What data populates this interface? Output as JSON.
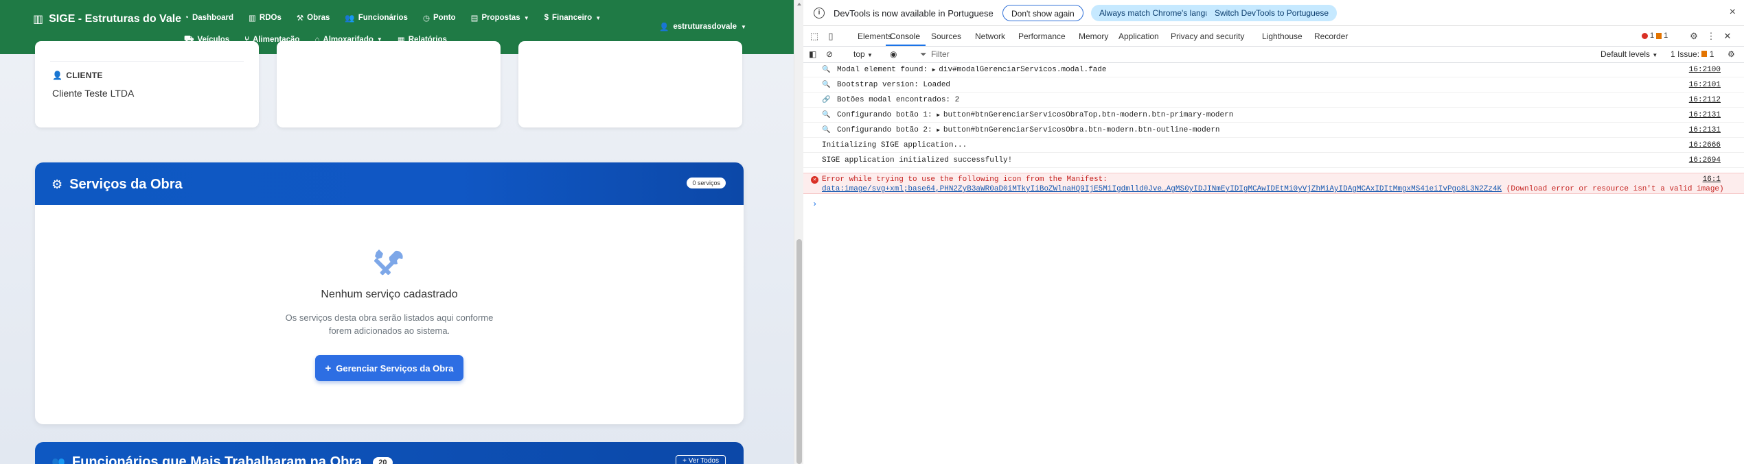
{
  "navbar": {
    "brand": "SIGE - Estruturas do Vale",
    "row1": [
      {
        "icon": "dashboard-icon",
        "glyph": "◔",
        "label": "Dashboard",
        "caret": false
      },
      {
        "icon": "building-icon",
        "glyph": "▥",
        "label": "RDOs",
        "caret": false
      },
      {
        "icon": "hammer-icon",
        "glyph": "⚒",
        "label": "Obras",
        "caret": false
      },
      {
        "icon": "users-icon",
        "glyph": "👥",
        "label": "Funcionários",
        "caret": false
      },
      {
        "icon": "clock-icon",
        "glyph": "◷",
        "label": "Ponto",
        "caret": false
      },
      {
        "icon": "file-icon",
        "glyph": "▤",
        "label": "Propostas",
        "caret": true
      },
      {
        "icon": "dollar-icon",
        "glyph": "$",
        "label": "Financeiro",
        "caret": true
      }
    ],
    "row2": [
      {
        "icon": "car-icon",
        "glyph": "⛟",
        "label": "Veículos",
        "caret": false
      },
      {
        "icon": "utensils-icon",
        "glyph": "⑂",
        "label": "Alimentação",
        "caret": false
      },
      {
        "icon": "warehouse-icon",
        "glyph": "⌂",
        "label": "Almoxarifado",
        "caret": true
      },
      {
        "icon": "chart-icon",
        "glyph": "▦",
        "label": "Relatórios",
        "caret": false
      }
    ],
    "user": "estruturasdovale"
  },
  "client": {
    "label": "CLIENTE",
    "name": "Cliente Teste LTDA"
  },
  "services": {
    "title": "Serviços da Obra",
    "badge": "0 serviços",
    "empty_title": "Nenhum serviço cadastrado",
    "empty_desc": "Os serviços desta obra serão listados aqui conforme forem adicionados ao sistema.",
    "button_label": "Gerenciar Serviços da Obra"
  },
  "workers": {
    "title": "Funcionários que Mais Trabalharam na Obra",
    "badge": "20",
    "button_label": "+ Ver Todos"
  },
  "devtools": {
    "infobar": {
      "message": "DevTools is now available in Portuguese",
      "btn_dont_show": "Don't show again",
      "btn_match": "Always match Chrome's language",
      "btn_switch": "Switch DevTools to Portuguese"
    },
    "tabs": [
      "Elements",
      "Console",
      "Sources",
      "Network",
      "Performance",
      "Memory",
      "Application",
      "Privacy and security",
      "Lighthouse",
      "Recorder"
    ],
    "active_tab": "Console",
    "errors": "1",
    "warnings": "1",
    "filter": {
      "context": "top",
      "placeholder": "Filter",
      "levels": "Default levels",
      "issues": "1 Issue:",
      "issues_count": "1"
    },
    "logs": [
      {
        "icon": "search-icon",
        "glyph": "🔍",
        "text": "Modal element found: ",
        "extra": "div#modalGerenciarServicos.modal.fade",
        "tri": true,
        "src": "16:2100"
      },
      {
        "icon": "search-icon",
        "glyph": "🔍",
        "text": "Bootstrap version: Loaded",
        "extra": "",
        "tri": false,
        "src": "16:2101"
      },
      {
        "icon": "link-icon",
        "glyph": "🔗",
        "text": "Botões modal encontrados: 2",
        "extra": "",
        "tri": false,
        "src": "16:2112"
      },
      {
        "icon": "search-icon",
        "glyph": "🔍",
        "text": "Configurando botão 1: ",
        "extra": "button#btnGerenciarServicosObraTop.btn-modern.btn-primary-modern",
        "tri": true,
        "src": "16:2131"
      },
      {
        "icon": "search-icon",
        "glyph": "🔍",
        "text": "Configurando botão 2: ",
        "extra": "button#btnGerenciarServicosObra.btn-modern.btn-outline-modern",
        "tri": true,
        "src": "16:2131"
      },
      {
        "icon": "",
        "glyph": "",
        "text": "Initializing SIGE application...",
        "extra": "",
        "tri": false,
        "src": "16:2666"
      },
      {
        "icon": "",
        "glyph": "",
        "text": "SIGE application initialized successfully!",
        "extra": "",
        "tri": false,
        "src": "16:2694"
      }
    ],
    "error": {
      "line1": "Error while trying to use the following icon from the Manifest:",
      "url": "data:image/svg+xml;base64,PHN2ZyB3aWR0aD0iMTkyIiBoZWlnaHQ9IjE5MiIgdmlld0Jve…AgMS0yIDJINmEyIDIgMCAwIDEtMi0yVjZhMiAyIDAgMCAxIDItMmgxMS41eiIvPgo8L3N2Zz4K",
      "tail": " (Download error or resource isn't a valid image)",
      "src": "16:1"
    }
  }
}
